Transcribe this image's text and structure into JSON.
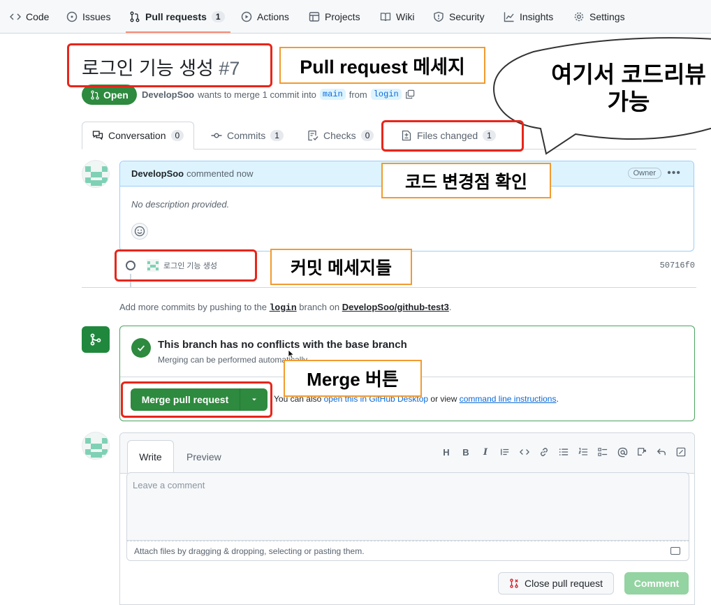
{
  "repo_nav": {
    "items": [
      {
        "label": "Code",
        "icon": "code-icon"
      },
      {
        "label": "Issues",
        "icon": "issue-icon"
      },
      {
        "label": "Pull requests",
        "icon": "pull-request-icon",
        "count": "1"
      },
      {
        "label": "Actions",
        "icon": "play-icon"
      },
      {
        "label": "Projects",
        "icon": "table-icon"
      },
      {
        "label": "Wiki",
        "icon": "book-icon"
      },
      {
        "label": "Security",
        "icon": "shield-icon"
      },
      {
        "label": "Insights",
        "icon": "graph-icon"
      },
      {
        "label": "Settings",
        "icon": "gear-icon"
      }
    ]
  },
  "pr": {
    "title": "로그인 기능 생성",
    "number": "#7",
    "state": "Open",
    "author": "DevelopSoo",
    "merge_text": "wants to merge 1 commit into",
    "base_branch": "main",
    "from_text": "from",
    "head_branch": "login"
  },
  "tabs": [
    {
      "label": "Conversation",
      "count": "0",
      "icon": "comment-discussion-icon"
    },
    {
      "label": "Commits",
      "count": "1",
      "icon": "commit-icon"
    },
    {
      "label": "Checks",
      "count": "0",
      "icon": "checklist-icon"
    },
    {
      "label": "Files changed",
      "count": "1",
      "icon": "file-diff-icon"
    }
  ],
  "comment": {
    "author": "DevelopSoo",
    "meta": "commented now",
    "badge": "Owner",
    "body": "No description provided."
  },
  "commit": {
    "message": "로그인 기능 생성",
    "sha": "50716f0"
  },
  "add_more": {
    "prefix": "Add more commits by pushing to the",
    "branch": "login",
    "middle": "branch on",
    "repo": "DevelopSoo/github-test3",
    "suffix": "."
  },
  "merge": {
    "title": "This branch has no conflicts with the base branch",
    "subtitle": "Merging can be performed automatically.",
    "button": "Merge pull request",
    "hint_prefix": "You can also",
    "hint_link1": "open this in GitHub Desktop",
    "hint_middle": "or view",
    "hint_link2": "command line instructions",
    "hint_suffix": "."
  },
  "write": {
    "tab_write": "Write",
    "tab_preview": "Preview",
    "placeholder": "Leave a comment",
    "attach": "Attach files by dragging & dropping, selecting or pasting them.",
    "close_button": "Close pull request",
    "comment_button": "Comment",
    "toolbar": [
      "H",
      "B",
      "I"
    ]
  },
  "annotations": {
    "pr_message": "Pull request 메세지",
    "bubble": "여기서 코드리뷰 가능",
    "code_changes": "코드 변경점 확인",
    "commit_messages": "커밋 메세지들",
    "merge_button": "Merge 버튼"
  },
  "colors": {
    "annotation_red": "#e8251a",
    "annotation_orange": "#f29a2e",
    "merge_green": "#2d8a3e",
    "comment_header": "#ddf4ff"
  }
}
